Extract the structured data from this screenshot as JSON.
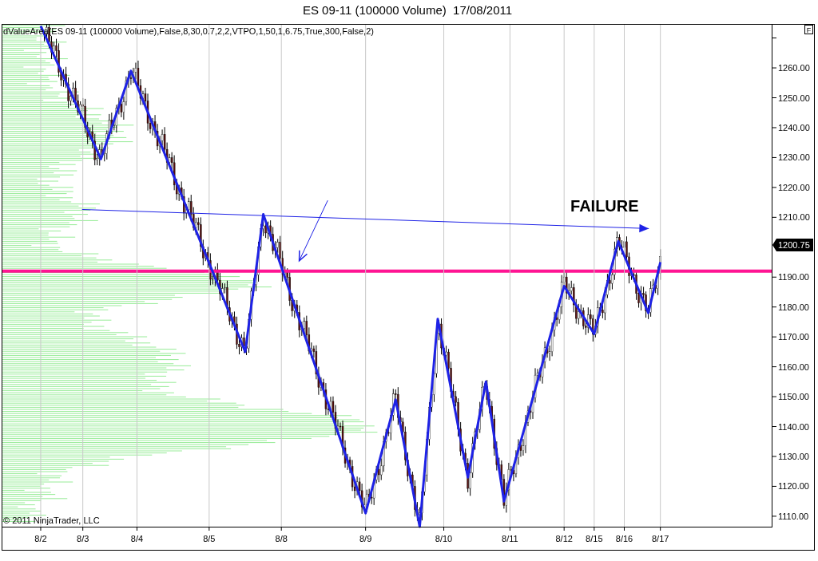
{
  "window": {
    "title": "ES 09-11 (100000 Volume)  17/08/2011"
  },
  "chart": {
    "indicator_label": "dValueArea(ES 09-11 (100000 Volume),False,8,30,0.7,2,2,VTPO,1,50,1,6.75,True,300,False,2)",
    "corner_button": "F",
    "last_price": "1200.75",
    "copyright": "© 2011 NinjaTrader, LLC",
    "chart_data": {
      "type": "line",
      "categories": [
        null,
        null,
        null,
        null,
        null,
        null,
        "8/2",
        null,
        null,
        null,
        null,
        null,
        null,
        "8/3",
        null,
        null,
        null,
        null,
        null,
        null,
        null,
        null,
        "8/4",
        null,
        null,
        null,
        null,
        null,
        null,
        null,
        null,
        null,
        null,
        null,
        "8/5",
        null,
        null,
        null,
        null,
        null,
        null,
        null,
        null,
        null,
        null,
        null,
        "8/8",
        null,
        null,
        null,
        null,
        null,
        null,
        null,
        null,
        null,
        null,
        null,
        null,
        null,
        "8/9",
        null,
        null,
        null,
        null,
        null,
        null,
        null,
        null,
        null,
        null,
        null,
        null,
        "8/10",
        null,
        null,
        null,
        null,
        null,
        null,
        null,
        null,
        null,
        null,
        "8/11",
        null,
        null,
        null,
        null,
        null,
        null,
        null,
        null,
        "8/12",
        null,
        null,
        null,
        null,
        "8/15",
        null,
        null,
        null,
        null,
        "8/16",
        null,
        null,
        null,
        null,
        null,
        "8/17",
        null,
        null,
        null,
        null,
        null,
        null,
        null,
        null,
        null,
        null,
        null,
        null,
        null,
        null,
        null,
        null,
        null,
        null
      ],
      "series": [
        {
          "color": "#1e22e6",
          "values": [
            null,
            null,
            null,
            null,
            null,
            null,
            1274,
            1269.6,
            1265.1,
            1260.7,
            1256.2,
            1251.8,
            1247.3,
            1242.9,
            1238.4,
            1234,
            1229.5,
            1235.4,
            1241.3,
            1247.2,
            1253.1,
            1259,
            1254.1,
            1249.1,
            1244.2,
            1239.2,
            1234.3,
            1229.3,
            1224.4,
            1219.4,
            1214.5,
            1209.5,
            1204.6,
            1199.6,
            1194.7,
            1189.7,
            1184.8,
            1179.8,
            1174.9,
            1169.9,
            1165,
            1180.3,
            1195.7,
            1211,
            1205.1,
            1199.2,
            1193.4,
            1187.5,
            1181.6,
            1175.7,
            1169.8,
            1163.9,
            1158.1,
            1152.2,
            1146.3,
            1140.4,
            1134.5,
            1128.6,
            1122.8,
            1116.9,
            1111,
            1118.6,
            1126.2,
            1133.8,
            1141.4,
            1149,
            1138.4,
            1127.8,
            1117.1,
            1106.5,
            1129.7,
            1152.8,
            1176,
            1165.4,
            1154.8,
            1144.2,
            1133.6,
            1123,
            1133.7,
            1144.3,
            1155,
            1141.7,
            1128.3,
            1115,
            1122.2,
            1129.4,
            1136.6,
            1143.8,
            1151,
            1158.2,
            1165.4,
            1172.6,
            1179.8,
            1187,
            1183.8,
            1180.6,
            1177.4,
            1174.2,
            1171,
            1178.8,
            1186.5,
            1194.3,
            1202,
            1197.2,
            1192.4,
            1187.6,
            1182.8,
            1178,
            1186.5,
            1195,
            null,
            null,
            null,
            null,
            null,
            null,
            null,
            null,
            null,
            null,
            null,
            null,
            null,
            null,
            null,
            null,
            null,
            null
          ]
        }
      ],
      "ylim": [
        1106.5,
        1274.7
      ],
      "yticks": [
        {
          "value": 1110,
          "label": "1110.00"
        },
        {
          "value": 1120,
          "label": "1120.00"
        },
        {
          "value": 1130,
          "label": "1130.00"
        },
        {
          "value": 1140,
          "label": "1140.00"
        },
        {
          "value": 1150,
          "label": "1150.00"
        },
        {
          "value": 1160,
          "label": "1160.00"
        },
        {
          "value": 1170,
          "label": "1170.00"
        },
        {
          "value": 1180,
          "label": "1180.00"
        },
        {
          "value": 1190,
          "label": "1190.00"
        },
        {
          "value": 1210,
          "label": "1210.00"
        },
        {
          "value": 1220,
          "label": "1220.00"
        },
        {
          "value": 1230,
          "label": "1230.00"
        },
        {
          "value": 1240,
          "label": "1240.00"
        },
        {
          "value": 1250,
          "label": "1250.00"
        },
        {
          "value": 1260,
          "label": "1260.00"
        }
      ],
      "annotations": [
        "FAILURE"
      ]
    }
  }
}
